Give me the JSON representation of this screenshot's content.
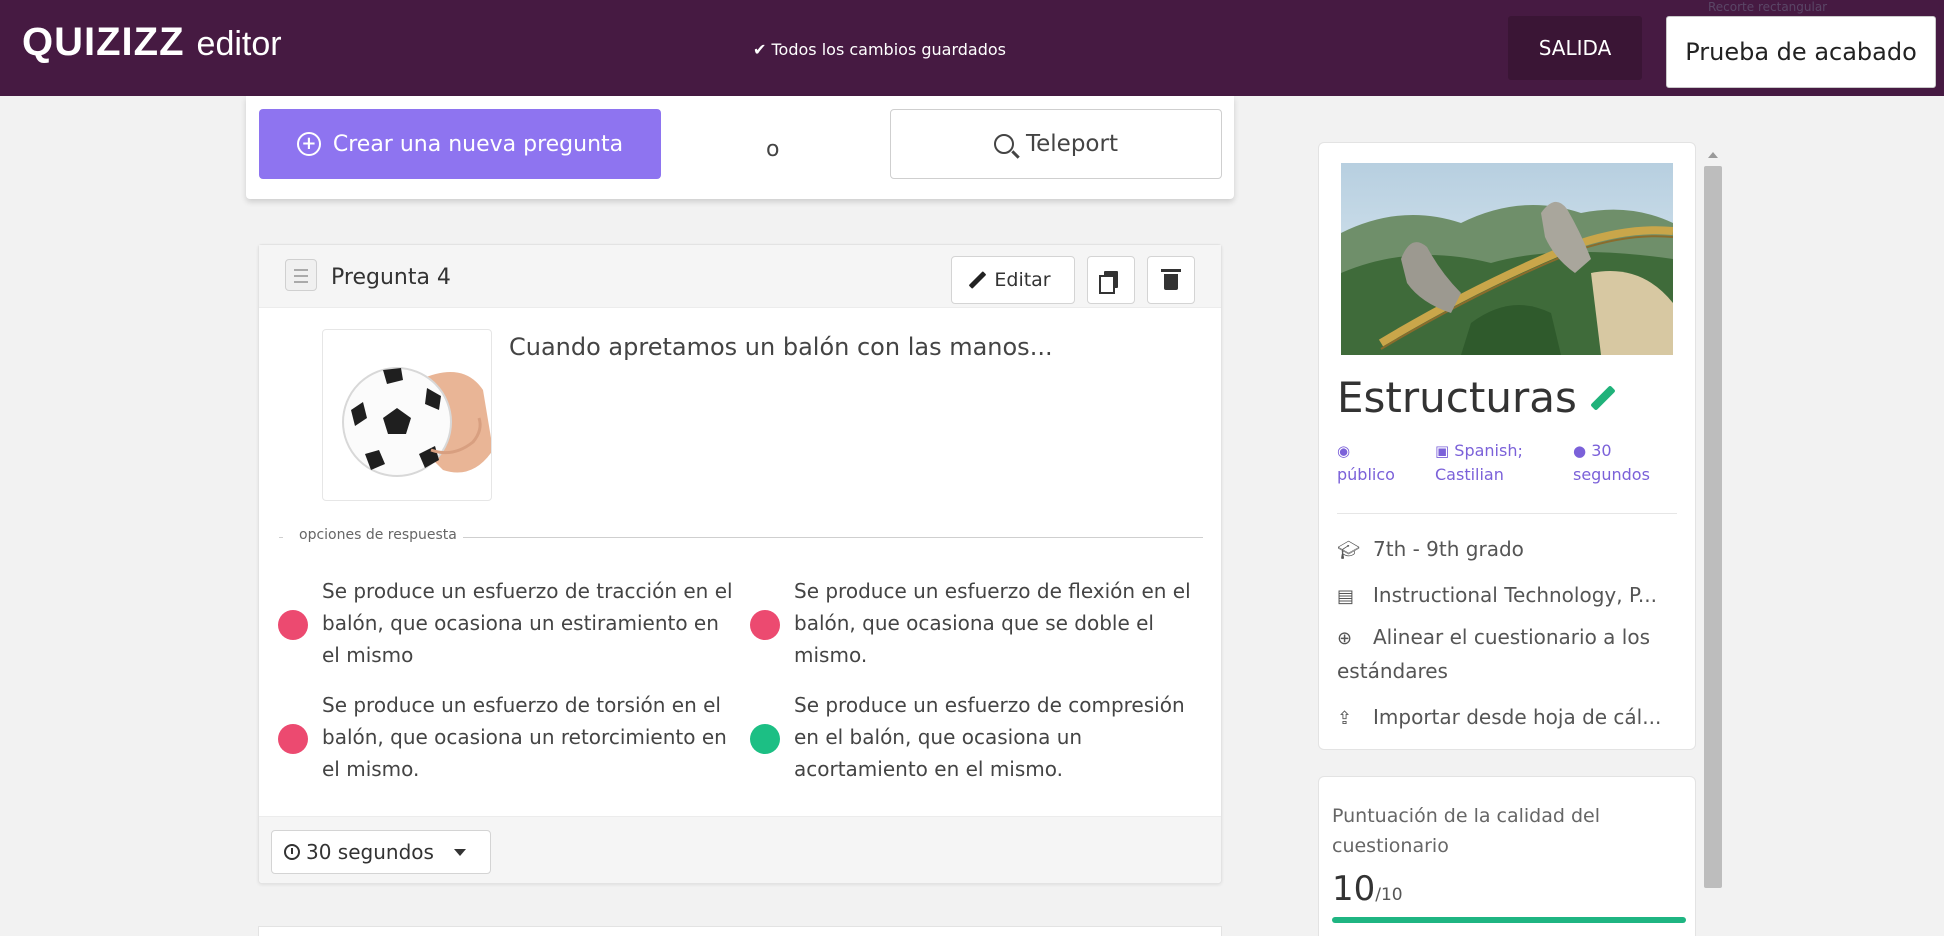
{
  "header": {
    "logo_word": "QUIZIZZ",
    "logo_sub": "editor",
    "save_status": "✔ Todos los cambios guardados",
    "exit_label": "SALIDA",
    "finish_label": "Prueba de acabado",
    "snip_hint": "Recorte rectangular",
    "bg_color": "#461a42"
  },
  "create_bar": {
    "create_label": "Crear una nueva pregunta",
    "or_label": "o",
    "teleport_label": "Teleport",
    "accent_color": "#8e74f0"
  },
  "question": {
    "title": "Pregunta 4",
    "edit_label": "Editar",
    "text": "Cuando apretamos un balón con las manos...",
    "options_label": "opciones de respuesta",
    "options": [
      {
        "text": "Se produce un esfuerzo de tracción en el balón, que ocasiona un estiramiento en el mismo",
        "correct": false,
        "color": "#ec4a70"
      },
      {
        "text": "Se produce un esfuerzo de flexión en el balón, que ocasiona que se doble el mismo.",
        "correct": false,
        "color": "#ec4a70"
      },
      {
        "text": "Se produce un esfuerzo de torsión en el balón, que ocasiona un retorcimiento en el mismo.",
        "correct": false,
        "color": "#ec4a70"
      },
      {
        "text": "Se produce un esfuerzo de compresión en el balón, que ocasiona un acortamiento en el mismo.",
        "correct": true,
        "color": "#1cbf84"
      }
    ],
    "time_label": "30 segundos"
  },
  "sidebar": {
    "quiz_title": "Estructuras",
    "visibility_icon": "eye-icon",
    "visibility": "público",
    "language": "Spanish; Castilian",
    "language_icon": "language-icon",
    "duration": "30 segundos",
    "duration_icon": "clock-icon",
    "grade": "7th - 9th grado",
    "subject": "Instructional Technology, P...",
    "align_label": "Alinear el cuestionario a los estándares",
    "import_label": "Importar desde hoja de cál..."
  },
  "quality": {
    "label": "Puntuación de la calidad del cuestionario",
    "score": "10",
    "max": "/10",
    "fraction": 1.0
  }
}
